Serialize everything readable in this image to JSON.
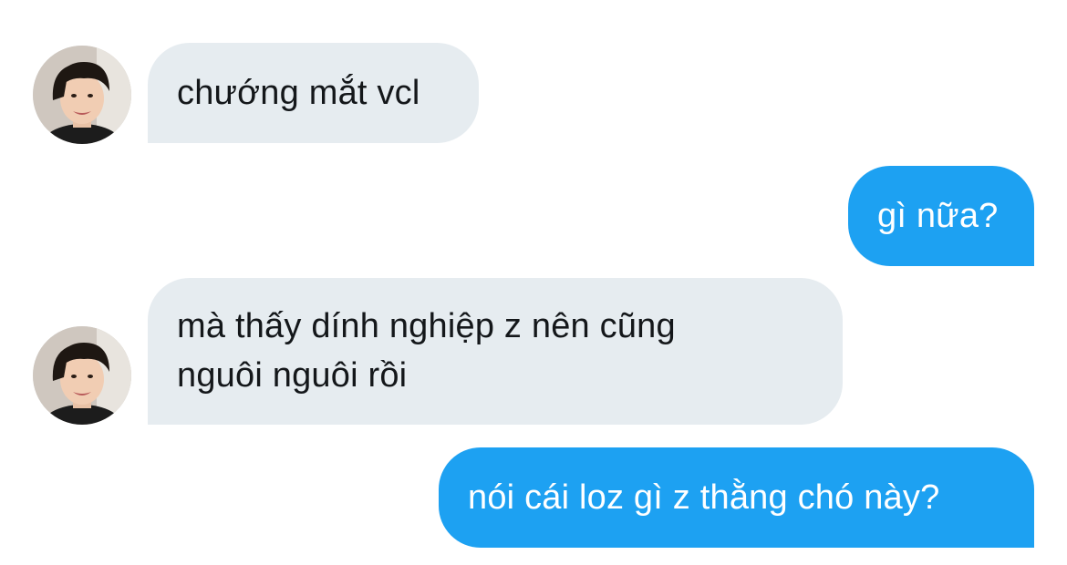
{
  "conversation": {
    "messages": [
      {
        "sender": "other",
        "lines": [
          "chướng mắt vcl"
        ]
      },
      {
        "sender": "self",
        "lines": [
          "gì nữa?"
        ]
      },
      {
        "sender": "other",
        "lines": [
          "mà thấy dính nghiệp z nên cũng",
          "nguôi nguôi rồi"
        ]
      },
      {
        "sender": "self",
        "lines": [
          "nói cái loz gì z thằng chó này?"
        ]
      }
    ]
  },
  "colors": {
    "incoming_bubble": "#e6ecf0",
    "incoming_text": "#14171a",
    "outgoing_bubble": "#1da1f2",
    "outgoing_text": "#ffffff"
  }
}
